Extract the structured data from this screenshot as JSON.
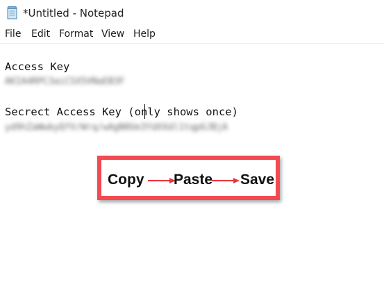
{
  "window": {
    "title": "*Untitled - Notepad"
  },
  "menu": {
    "items": [
      "File",
      "Edit",
      "Format",
      "View",
      "Help"
    ]
  },
  "editor": {
    "line1": "Access Key",
    "line1_value_redacted": "AKIA4RPC3aiCSX5VNaEB3F",
    "line2": "Secrect Access Key (only shows once)",
    "line2_value_redacted": "yd9hZaWwbyQfV/Wrq/wAgN0Ue3YdXXdl1tqp6JBjA"
  },
  "callout": {
    "step1": "Copy",
    "step2": "Paste",
    "step3": "Save",
    "border_color": "#f24a50",
    "arrow_color": "#e8353c"
  },
  "icons": {
    "app": "notepad-icon",
    "arrow": "right-arrow-icon"
  }
}
